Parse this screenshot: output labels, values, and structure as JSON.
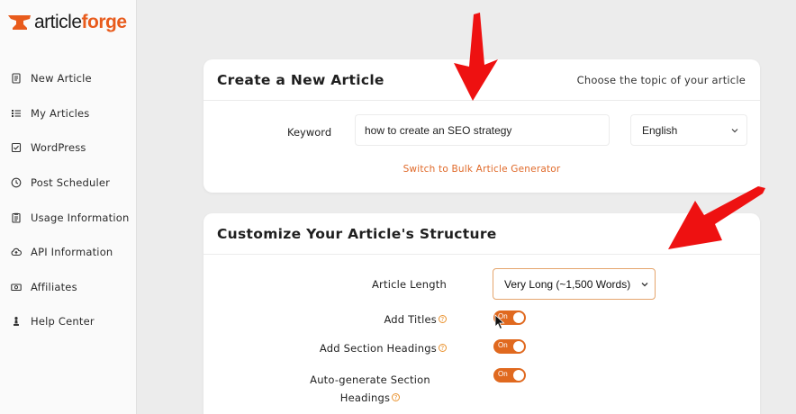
{
  "brand": {
    "part1": "article",
    "part2": "forge",
    "accent": "#e85b1c"
  },
  "sidebar": {
    "items": [
      {
        "label": "New Article",
        "icon": "document-icon"
      },
      {
        "label": "My Articles",
        "icon": "list-icon"
      },
      {
        "label": "WordPress",
        "icon": "checkbox-icon"
      },
      {
        "label": "Post Scheduler",
        "icon": "clock-icon"
      },
      {
        "label": "Usage Information",
        "icon": "clipboard-icon"
      },
      {
        "label": "API Information",
        "icon": "cloud-upload-icon"
      },
      {
        "label": "Affiliates",
        "icon": "money-icon"
      },
      {
        "label": "Help Center",
        "icon": "chess-pawn-icon"
      }
    ]
  },
  "create": {
    "title": "Create a New Article",
    "subtitle": "Choose the topic of your article",
    "keyword_label": "Keyword",
    "keyword_value": "how to create an SEO strategy",
    "language": "English",
    "bulk_link": "Switch to Bulk Article Generator"
  },
  "structure": {
    "title": "Customize Your Article's Structure",
    "length_label": "Article Length",
    "length_value": "Very Long (~1,500 Words)",
    "titles_label": "Add Titles",
    "headings_label": "Add Section Headings",
    "auto_label_line1": "Auto-generate Section",
    "auto_label_line2": "Headings",
    "toggle_on": "On",
    "help_mark": "?"
  }
}
